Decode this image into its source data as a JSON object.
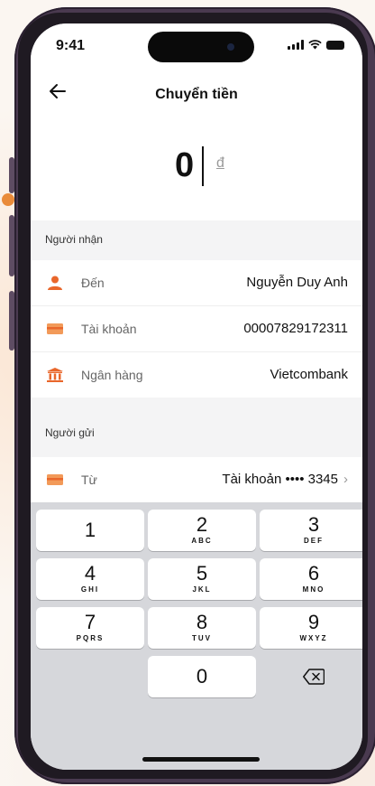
{
  "status_bar": {
    "time": "9:41"
  },
  "header": {
    "title": "Chuyển tiền"
  },
  "amount": {
    "value": "0",
    "currency": "đ"
  },
  "recipient": {
    "section_label": "Người nhận",
    "rows": [
      {
        "label": "Đến",
        "value": "Nguyễn Duy Anh",
        "icon": "person-icon"
      },
      {
        "label": "Tài khoản",
        "value": "00007829172311",
        "icon": "card-icon"
      },
      {
        "label": "Ngân hàng",
        "value": "Vietcombank",
        "icon": "bank-icon"
      }
    ]
  },
  "sender": {
    "section_label": "Người gửi",
    "row": {
      "label": "Từ",
      "value": "Tài khoản •••• 3345",
      "icon": "card-icon"
    }
  },
  "keypad": {
    "keys": [
      {
        "num": "1",
        "letters": ""
      },
      {
        "num": "2",
        "letters": "ABC"
      },
      {
        "num": "3",
        "letters": "DEF"
      },
      {
        "num": "4",
        "letters": "GHI"
      },
      {
        "num": "5",
        "letters": "JKL"
      },
      {
        "num": "6",
        "letters": "MNO"
      },
      {
        "num": "7",
        "letters": "PQRS"
      },
      {
        "num": "8",
        "letters": "TUV"
      },
      {
        "num": "9",
        "letters": "WXYZ"
      },
      {
        "num": "0",
        "letters": ""
      }
    ]
  },
  "colors": {
    "accent": "#e9672b",
    "keypad_bg": "#d6d7db"
  }
}
